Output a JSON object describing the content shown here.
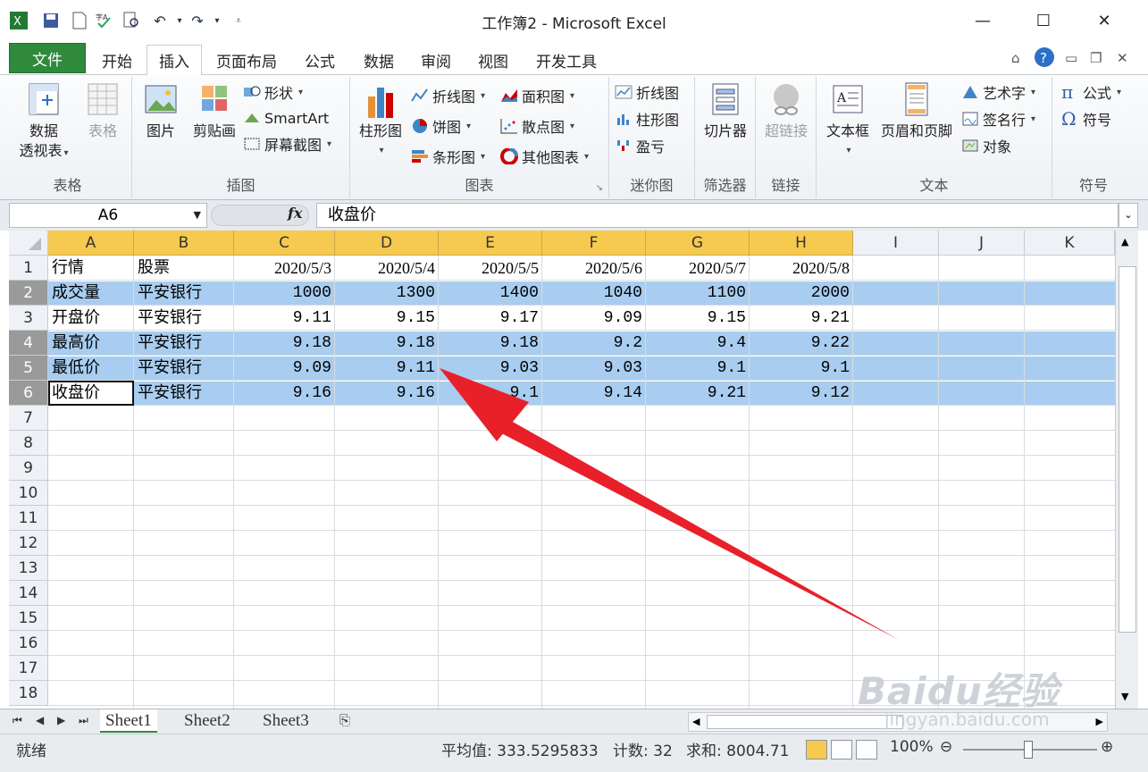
{
  "window": {
    "title": "工作簿2 - Microsoft Excel",
    "minimize_icon": "minimize-icon",
    "maximize_icon": "maximize-icon",
    "close_icon": "close-icon"
  },
  "ribbon_tabs": [
    "文件",
    "开始",
    "插入",
    "页面布局",
    "公式",
    "数据",
    "审阅",
    "视图",
    "开发工具"
  ],
  "active_tab": "插入",
  "ribbon": {
    "groups": {
      "tables": {
        "label": "表格",
        "pivot": "数据\n透视表",
        "pivot_line1": "数据",
        "pivot_line2": "透视表",
        "table": "表格"
      },
      "illustrations": {
        "label": "插图",
        "picture": "图片",
        "clipart": "剪贴画",
        "shapes": "形状",
        "smartart": "SmartArt",
        "screenshot": "屏幕截图"
      },
      "charts": {
        "label": "图表",
        "column": "柱形图",
        "line": "折线图",
        "pie": "饼图",
        "bar": "条形图",
        "area": "面积图",
        "scatter": "散点图",
        "other": "其他图表"
      },
      "sparklines": {
        "label": "迷你图",
        "line": "折线图",
        "column": "柱形图",
        "winloss": "盈亏"
      },
      "filter": {
        "label": "筛选器",
        "slicer": "切片器"
      },
      "links": {
        "label": "链接",
        "hyperlink": "超链接"
      },
      "text": {
        "label": "文本",
        "textbox": "文本框",
        "header_footer": "页眉和页脚",
        "wordart": "艺术字",
        "signature": "签名行",
        "object": "对象"
      },
      "symbols": {
        "label": "符号",
        "equation": "公式",
        "symbol": "符号"
      }
    }
  },
  "formula_bar": {
    "name_box": "A6",
    "fx": "fx",
    "content": "收盘价"
  },
  "grid": {
    "columns": [
      "A",
      "B",
      "C",
      "D",
      "E",
      "F",
      "G",
      "H",
      "I",
      "J",
      "K"
    ],
    "row_numbers": [
      "1",
      "2",
      "3",
      "4",
      "5",
      "6",
      "7",
      "8",
      "9",
      "10",
      "11",
      "12",
      "13",
      "14",
      "15",
      "16",
      "17",
      "18"
    ],
    "rows": [
      [
        "行情",
        "股票",
        "2020/5/3",
        "2020/5/4",
        "2020/5/5",
        "2020/5/6",
        "2020/5/7",
        "2020/5/8"
      ],
      [
        "成交量",
        "平安银行",
        "1000",
        "1300",
        "1400",
        "1040",
        "1100",
        "2000"
      ],
      [
        "开盘价",
        "平安银行",
        "9.11",
        "9.15",
        "9.17",
        "9.09",
        "9.15",
        "9.21"
      ],
      [
        "最高价",
        "平安银行",
        "9.18",
        "9.18",
        "9.18",
        "9.2",
        "9.4",
        "9.22"
      ],
      [
        "最低价",
        "平安银行",
        "9.09",
        "9.11",
        "9.03",
        "9.03",
        "9.1",
        "9.1"
      ],
      [
        "收盘价",
        "平安银行",
        "9.16",
        "9.16",
        "9.1",
        "9.14",
        "9.21",
        "9.12"
      ]
    ],
    "selected_rows": [
      "2",
      "4",
      "5",
      "6"
    ],
    "active_cell": "A6",
    "selection_color": "#a8cdf0"
  },
  "sheet_tabs": [
    "Sheet1",
    "Sheet2",
    "Sheet3"
  ],
  "status_bar": {
    "mode": "就绪",
    "average": "平均值: 333.5295833",
    "count": "计数: 32",
    "sum": "求和: 8004.71",
    "zoom": "100%"
  },
  "watermark": {
    "brand": "Baidu经验",
    "url": "jingyan.baidu.com"
  },
  "colors": {
    "file_tab": "#2f8a3c",
    "header_highlight": "#f6c94f",
    "arrow": "#e8202a"
  }
}
